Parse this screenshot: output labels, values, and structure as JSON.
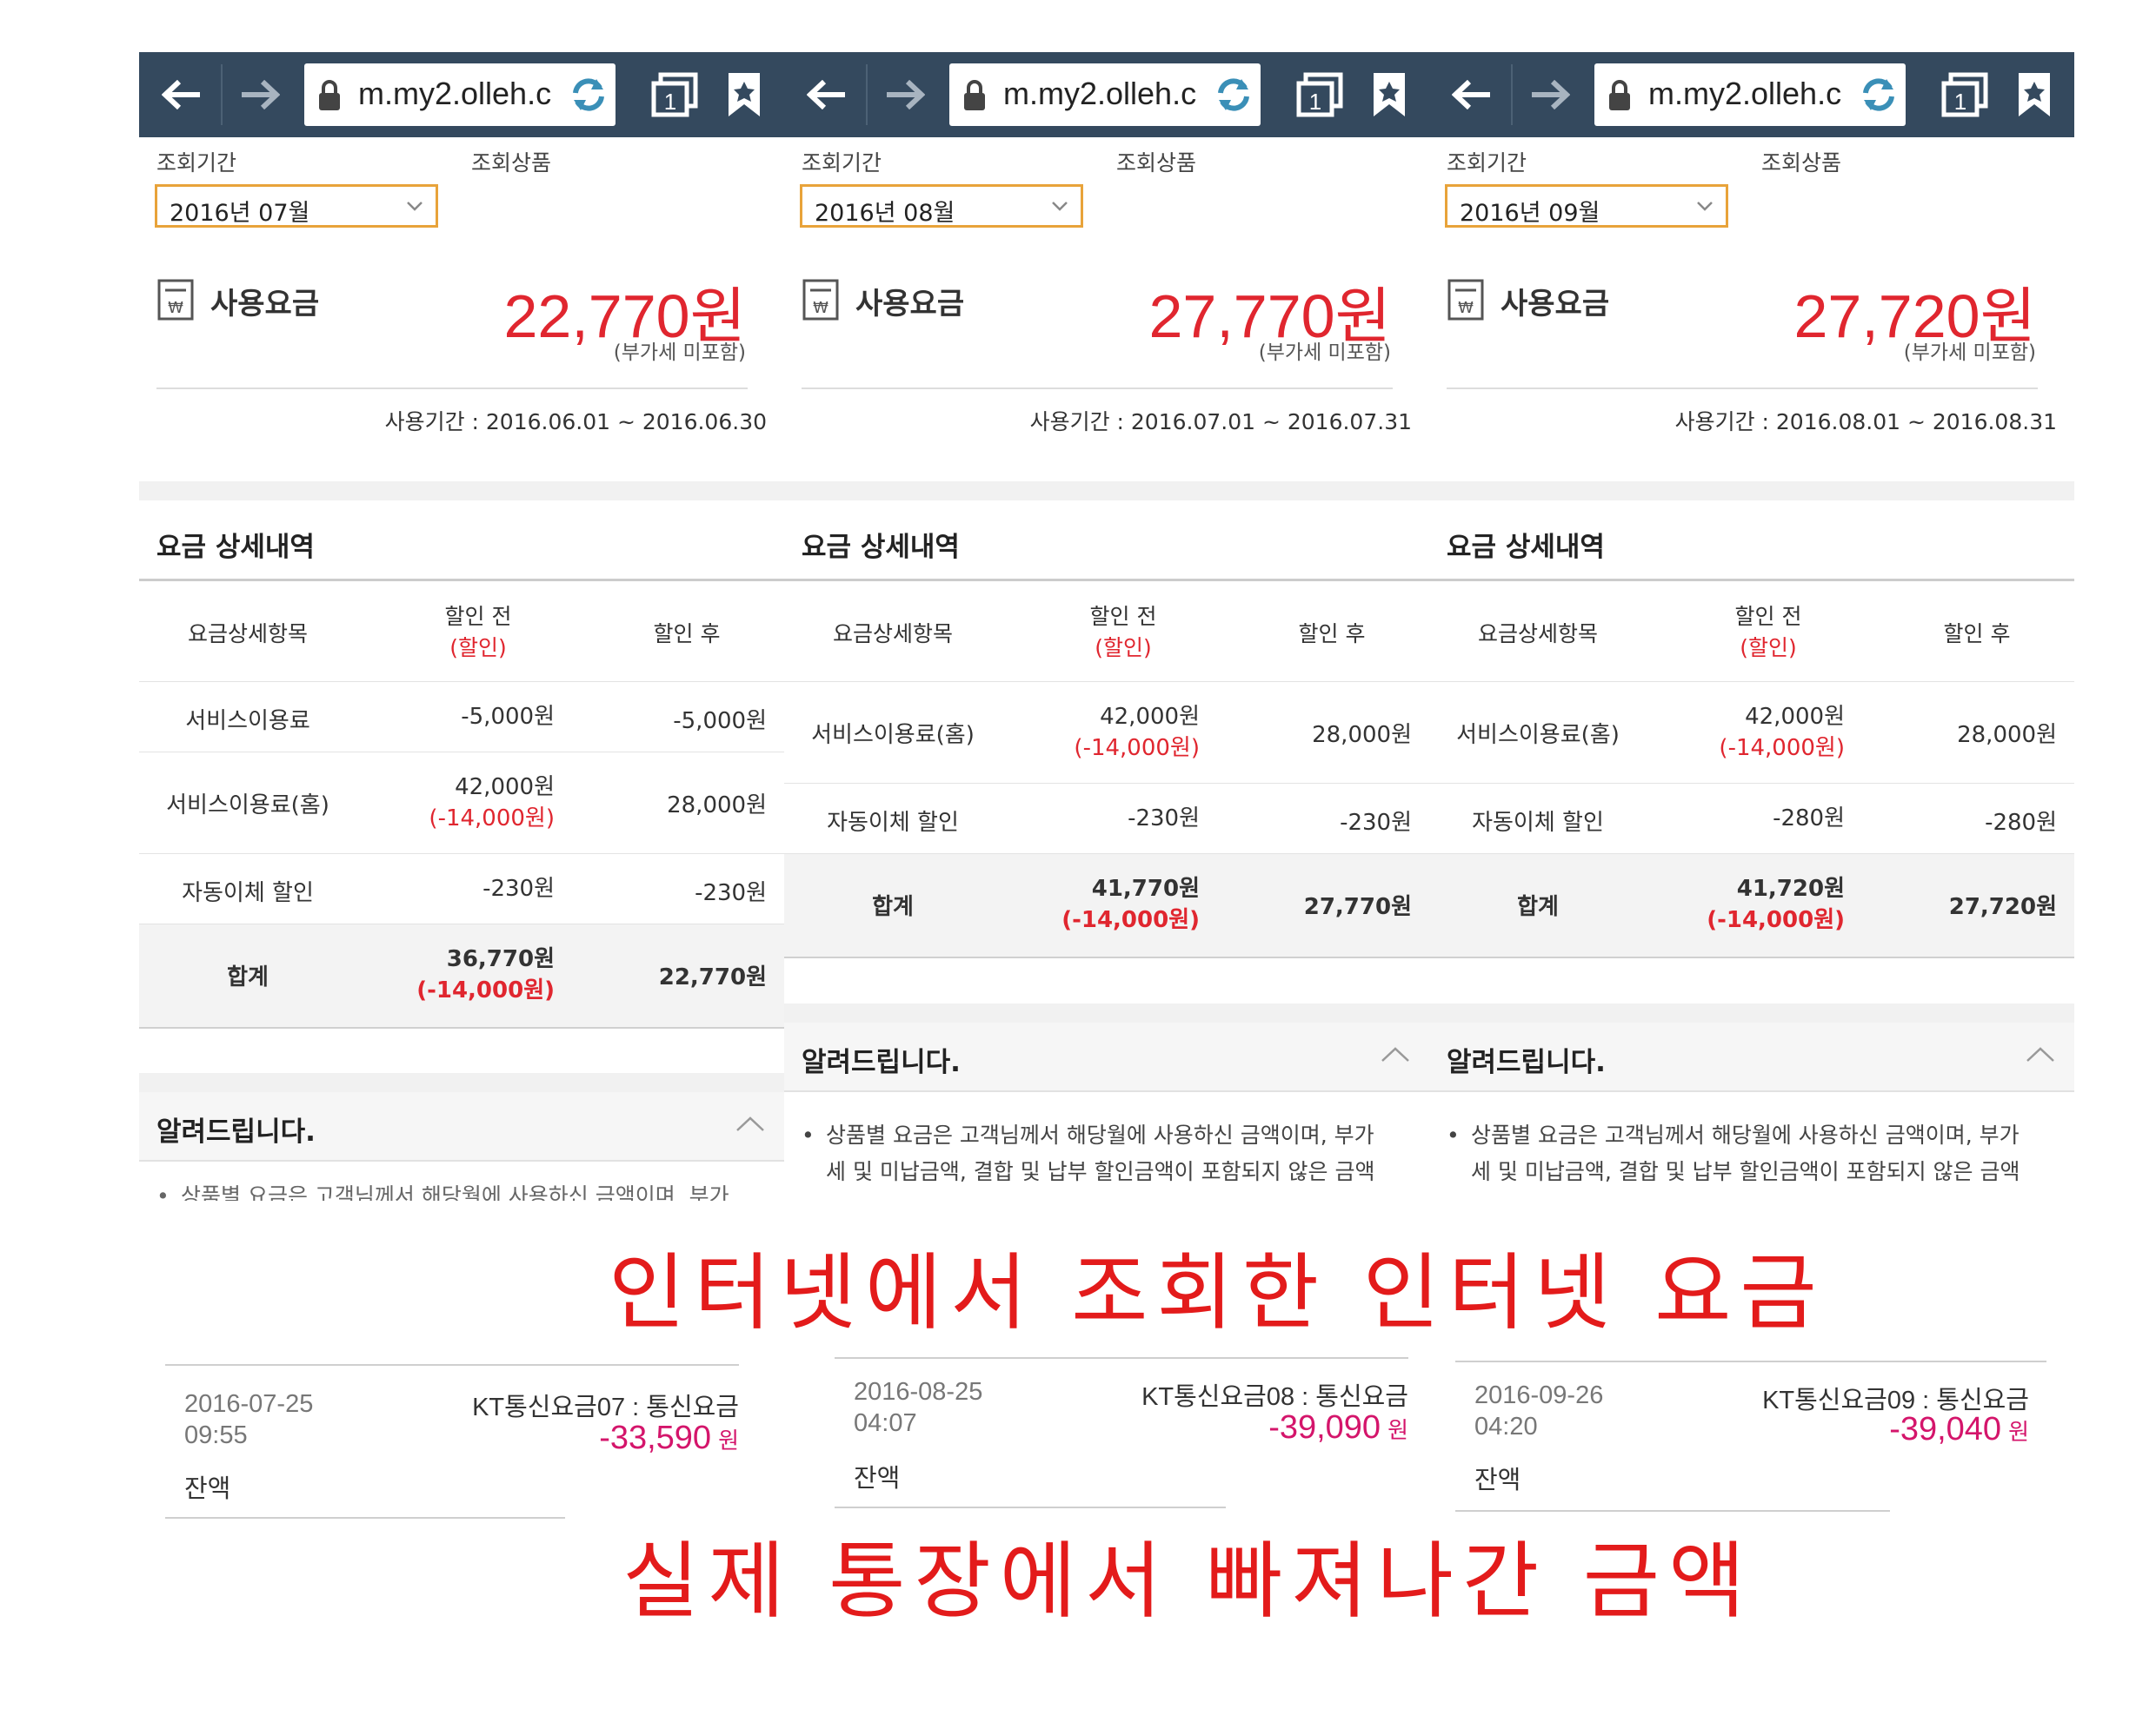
{
  "browser": {
    "url": "m.my2.olleh.c",
    "tab_count": "1"
  },
  "labels": {
    "period": "조회기간",
    "product": "조회상품",
    "usage_fee": "사용요금",
    "vat_note": "(부가세 미포함)",
    "detail_title": "요금 상세내역",
    "col_item": "요금상세항목",
    "col_before": "할인 전",
    "col_before_sub": "(할인)",
    "col_after": "할인 후",
    "notice_title": "알려드립니다.",
    "notice_bullet": "•",
    "notice_line1": "상품별 요금은 고객님께서 해당월에 사용하신 금액이며, 부가",
    "notice_line2": "세 및 미납금액, 결합 및 납부 할인금액이 포함되지 않은 금액"
  },
  "panels": [
    {
      "month": "2016년 07월",
      "amount": "22,770원",
      "period": "사용기간 : 2016.06.01 ~ 2016.06.30",
      "rows": [
        {
          "name": "서비스이용료",
          "before": "-5,000원",
          "disc": "",
          "after": "-5,000원"
        },
        {
          "name": "서비스이용료(홈)",
          "before": "42,000원",
          "disc": "(-14,000원)",
          "after": "28,000원"
        },
        {
          "name": "자동이체 할인",
          "before": "-230원",
          "disc": "",
          "after": "-230원"
        }
      ],
      "total": {
        "name": "합계",
        "before": "36,770원",
        "disc": "(-14,000원)",
        "after": "22,770원"
      }
    },
    {
      "month": "2016년 08월",
      "amount": "27,770원",
      "period": "사용기간 : 2016.07.01 ~ 2016.07.31",
      "rows": [
        {
          "name": "서비스이용료(홈)",
          "before": "42,000원",
          "disc": "(-14,000원)",
          "after": "28,000원"
        },
        {
          "name": "자동이체 할인",
          "before": "-230원",
          "disc": "",
          "after": "-230원"
        }
      ],
      "total": {
        "name": "합계",
        "before": "41,770원",
        "disc": "(-14,000원)",
        "after": "27,770원"
      }
    },
    {
      "month": "2016년 09월",
      "amount": "27,720원",
      "period": "사용기간 : 2016.08.01 ~ 2016.08.31",
      "rows": [
        {
          "name": "서비스이용료(홈)",
          "before": "42,000원",
          "disc": "(-14,000원)",
          "after": "28,000원"
        },
        {
          "name": "자동이체 할인",
          "before": "-280원",
          "disc": "",
          "after": "-280원"
        }
      ],
      "total": {
        "name": "합계",
        "before": "41,720원",
        "disc": "(-14,000원)",
        "after": "27,720원"
      }
    }
  ],
  "caption_top": "인터넷에서 조회한 인터넷 요금",
  "caption_bottom": "실제 통장에서 빠져나간 금액",
  "transactions": [
    {
      "date": "2016-07-25",
      "time": "09:55",
      "desc": "KT통신요금07 : 통신요금",
      "amount": "-33,590",
      "unit": "원",
      "balance_label": "잔액"
    },
    {
      "date": "2016-08-25",
      "time": "04:07",
      "desc": "KT통신요금08 : 통신요금",
      "amount": "-39,090",
      "unit": "원",
      "balance_label": "잔액"
    },
    {
      "date": "2016-09-26",
      "time": "04:20",
      "desc": "KT통신요금09 : 통신요금",
      "amount": "-39,040",
      "unit": "원",
      "balance_label": "잔액"
    }
  ],
  "colors": {
    "toolbar": "#34495e",
    "accent_red": "#e0262f",
    "select_border": "#e8a33a",
    "tx_amount": "#d4156b",
    "caption": "#e31b1b"
  }
}
